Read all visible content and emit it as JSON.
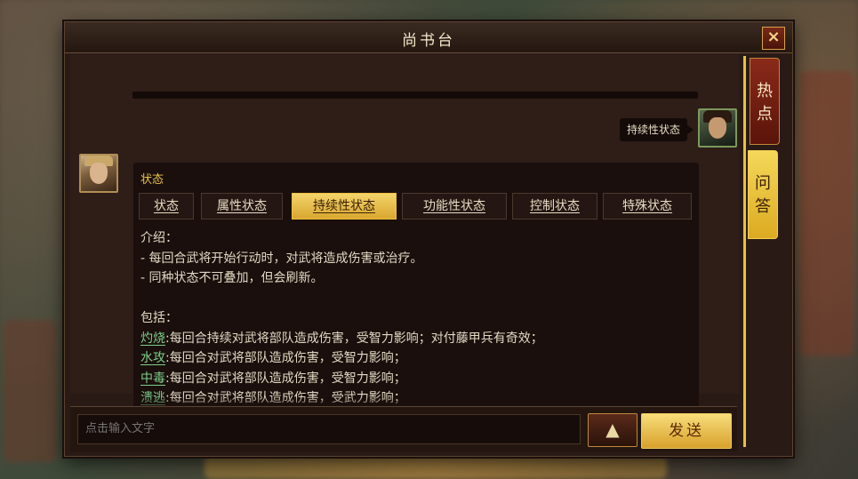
{
  "window": {
    "title": "尚书台",
    "close_icon": "×"
  },
  "side_tabs": [
    {
      "label": "热\n点",
      "active": false
    },
    {
      "label": "问\n答",
      "active": true
    }
  ],
  "user_message": "持续性状态",
  "answer": {
    "title": "状态",
    "tabs": [
      "状态",
      "属性状态",
      "持续性状态",
      "功能性状态",
      "控制状态",
      "特殊状态"
    ],
    "active_tab": "持续性状态",
    "intro_label": "介绍：",
    "intro_lines": [
      "- 每回合武将开始行动时，对武将造成伤害或治疗。",
      "- 同种状态不可叠加，但会刷新。"
    ],
    "include_label": "包括：",
    "entries": [
      {
        "term": "灼烧",
        "desc": ":每回合持续对武将部队造成伤害，受智力影响；对付藤甲兵有奇效；"
      },
      {
        "term": "水攻",
        "desc": ":每回合对武将部队造成伤害，受智力影响；"
      },
      {
        "term": "中毒",
        "desc": ":每回合对武将部队造成伤害，受智力影响；"
      },
      {
        "term": "溃逃",
        "desc": ":每回合对武将部队造成伤害，受武力影响；"
      }
    ]
  },
  "input": {
    "placeholder": "点击输入文字",
    "up_icon": "▲",
    "send_label": "发送"
  },
  "colors": {
    "accent": "#e8c24a",
    "term": "#7fcf8a",
    "active_tab": "#f3d46a"
  }
}
